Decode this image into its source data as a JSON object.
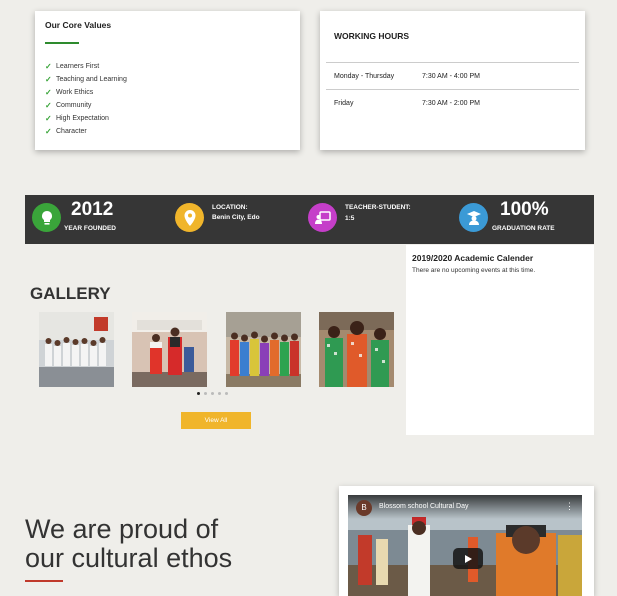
{
  "core_values": {
    "title": "Our Core Values",
    "items": [
      "Learners First",
      "Teaching and Learning",
      "Work Ethics",
      "Community",
      "High Expectation",
      "Character"
    ]
  },
  "working_hours": {
    "title": "WORKING HOURS",
    "rows": [
      {
        "days": "Monday - Thursday",
        "time": "7:30 AM - 4:00 PM"
      },
      {
        "days": "Friday",
        "time": "7:30 AM - 2:00 PM"
      }
    ]
  },
  "stats": {
    "year": {
      "value": "2012",
      "label": "YEAR FOUNDED",
      "icon": "lightbulb-icon",
      "color": "#3aa53a"
    },
    "location": {
      "title": "LOCATION:",
      "value": "Benin City, Edo",
      "icon": "map-pin-icon",
      "color": "#f0b52b"
    },
    "ratio": {
      "title": "TEACHER-STUDENT:",
      "value": "1:5",
      "icon": "teacher-board-icon",
      "color": "#c53ec9"
    },
    "graduation": {
      "value": "100%",
      "label": "GRADUATION RATE",
      "icon": "graduate-icon",
      "color": "#3b9ad6"
    }
  },
  "calendar": {
    "title": "2019/2020 Academic Calender",
    "empty_text": "There are no upcoming events at this time."
  },
  "gallery": {
    "title": "GALLERY",
    "view_all": "View All"
  },
  "culture": {
    "heading_line1": "We are proud of",
    "heading_line2": "our cultural ethos"
  },
  "video": {
    "channel_initial": "B",
    "title": "Blossom school Cultural Day"
  },
  "colors": {
    "accent_yellow": "#f0b52b",
    "accent_green": "#36a336",
    "stats_bg": "#363636",
    "heading_line_red": "#c0392b"
  }
}
